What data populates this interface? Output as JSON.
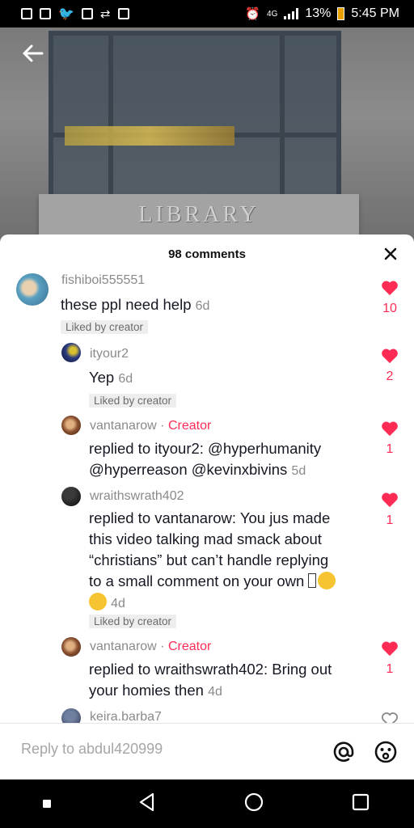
{
  "status_bar": {
    "battery": "13%",
    "time": "5:45 PM"
  },
  "video": {
    "sign_text": "LIBRARY"
  },
  "comments_panel": {
    "title": "98 comments",
    "liked_by_creator_label": "Liked by creator",
    "creator_badge": "Creator",
    "separator": "·"
  },
  "comments": [
    {
      "username": "fishiboi555551",
      "text": "these ppl need help",
      "age": "6d",
      "likes": "10",
      "liked_by_creator": true
    },
    {
      "username": "ityour2",
      "text": "Yep",
      "age": "6d",
      "likes": "2",
      "liked_by_creator": true
    },
    {
      "username": "vantanarow",
      "creator": true,
      "text_line1": "replied to ityour2: @hyperhumanity",
      "text_line2": "@hyperreason @kevinxbivins",
      "age": "5d",
      "likes": "1"
    },
    {
      "username": "wraithswrath402",
      "text_line1": "replied to vantanarow: You jus made",
      "text_line2": "this video talking mad smack about",
      "text_line3": "“christians” but can’t handle replying",
      "text_line4": "to a small comment on your own",
      "age": "4d",
      "likes": "1",
      "liked_by_creator": true
    },
    {
      "username": "vantanarow",
      "creator": true,
      "text_line1": "replied to wraithswrath402: Bring out",
      "text_line2": "your homies then",
      "age": "4d",
      "likes": "1"
    },
    {
      "username": "keira.barba7"
    }
  ],
  "reply_bar": {
    "placeholder": "Reply to abdul420999"
  },
  "icons": {
    "heart_color": "#fe2c55",
    "accent": "#fe2c55"
  }
}
